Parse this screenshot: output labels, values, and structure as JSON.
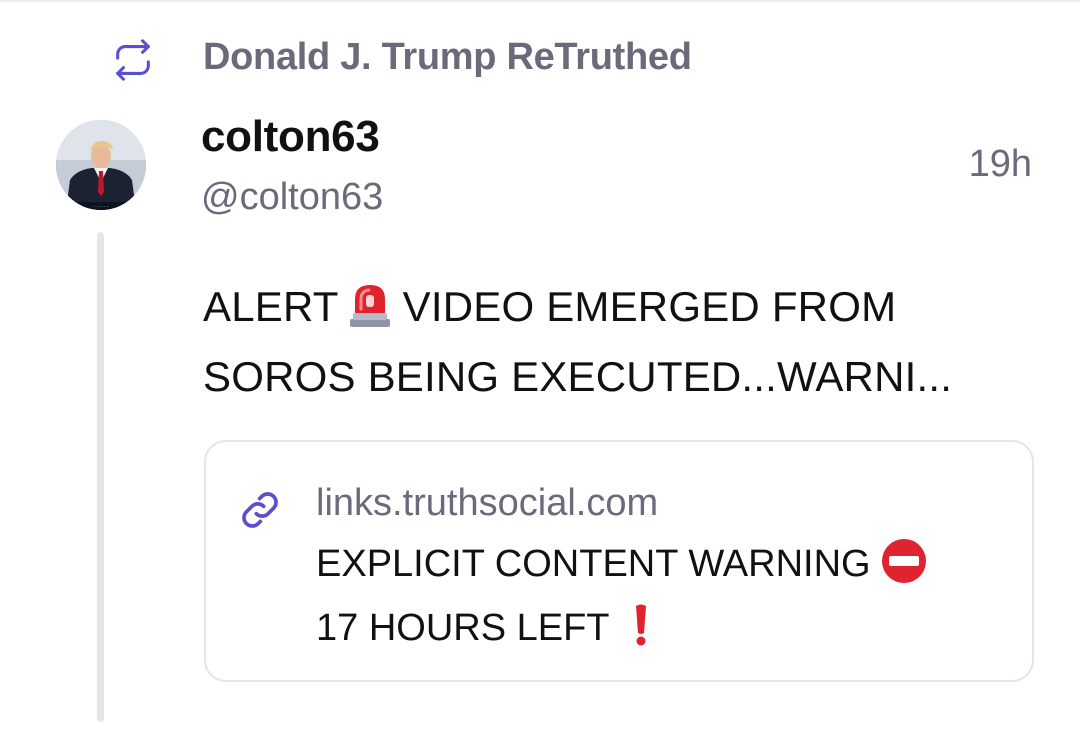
{
  "retruth": {
    "label": "Donald J. Trump ReTruthed",
    "icon": "retruth-icon",
    "accent": "#5a4fd1"
  },
  "post": {
    "display_name": "colton63",
    "handle": "@colton63",
    "timestamp": "19h",
    "avatar": "avatar",
    "text_line1_a": "ALERT",
    "text_line1_emoji": "police-light-icon",
    "text_line1_b": "VIDEO EMERGED FROM",
    "text_line2": "SOROS BEING EXECUTED...WARNI..."
  },
  "link_card": {
    "icon": "link-icon",
    "domain": "links.truthsocial.com",
    "line1": "EXPLICIT CONTENT WARNING",
    "line1_emoji": "no-entry-icon",
    "line2": "17 HOURS LEFT",
    "line2_emoji": "exclamation-icon"
  },
  "colors": {
    "muted_text": "#6b6a7a",
    "primary_text": "#111113",
    "border": "#e4e4ea",
    "emoji_red": "#e0242f"
  }
}
